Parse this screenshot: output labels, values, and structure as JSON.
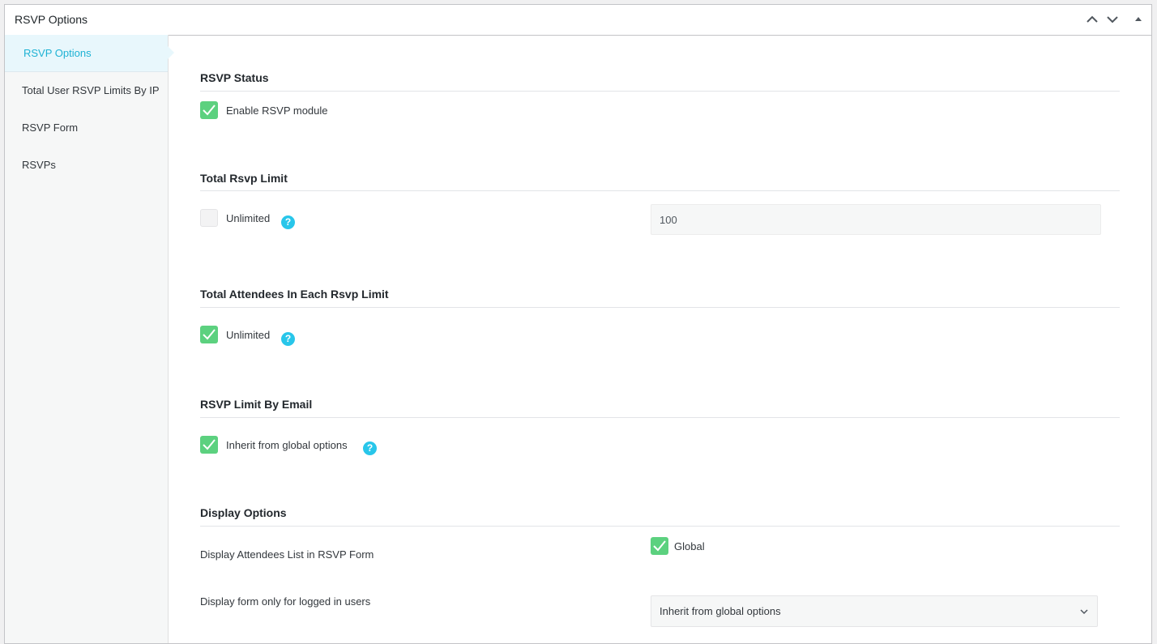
{
  "panel": {
    "title": "RSVP Options"
  },
  "sidebar": {
    "items": [
      {
        "label": "RSVP Options",
        "active": true
      },
      {
        "label": "Total User RSVP Limits By IP",
        "active": false
      },
      {
        "label": "RSVP Form",
        "active": false
      },
      {
        "label": "RSVPs",
        "active": false
      }
    ]
  },
  "sections": {
    "rsvp_status": {
      "title": "RSVP Status",
      "enable_label": "Enable RSVP module",
      "enable_checked": true
    },
    "total_limit": {
      "title": "Total Rsvp Limit",
      "unlimited_label": "Unlimited",
      "unlimited_checked": false,
      "limit_value": "100"
    },
    "attendees_limit": {
      "title": "Total Attendees In Each Rsvp Limit",
      "unlimited_label": "Unlimited",
      "unlimited_checked": true
    },
    "email_limit": {
      "title": "RSVP Limit By Email",
      "inherit_label": "Inherit from global options",
      "inherit_checked": true
    },
    "display": {
      "title": "Display Options",
      "attendees_list_label": "Display Attendees List in RSVP Form",
      "global_label": "Global",
      "global_checked": true,
      "logged_in_label": "Display form only for logged in users",
      "logged_in_value": "Inherit from global options"
    }
  },
  "icons": {
    "help": "help-icon",
    "collapse": "chevron-up-icon",
    "expand": "chevron-down-icon",
    "toggle": "triangle-up-icon"
  },
  "colors": {
    "accent": "#1eb2d4",
    "check_on": "#5cd17f",
    "help": "#28c6ea"
  }
}
